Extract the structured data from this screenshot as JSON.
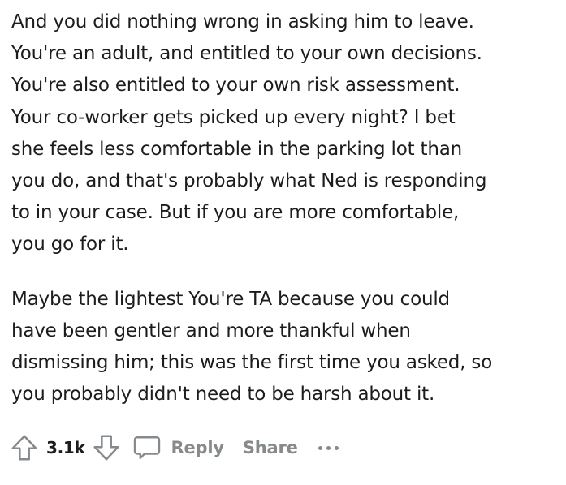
{
  "comment": {
    "paragraphs": [
      {
        "lines": [
          "And you did nothing wrong in asking him to leave.",
          "You're an adult, and entitled to your own decisions.",
          "You're also entitled to your own risk assessment.",
          "Your co-worker gets picked up every night? I bet",
          "she feels less comfortable in the parking lot than",
          "you do, and that's probably what Ned is responding",
          "to in your case. But if you are more comfortable,",
          "you go for it."
        ]
      },
      {
        "lines": [
          "Maybe the lightest You're TA because you could",
          "have been gentler and more thankful when",
          "dismissing him; this was the first time you asked, so",
          "you probably didn't need to be harsh about it."
        ]
      }
    ]
  },
  "actions": {
    "score": "3.1k",
    "reply_label": "Reply",
    "share_label": "Share",
    "icons": {
      "upvote": "upvote-arrow-icon",
      "downvote": "downvote-arrow-icon",
      "reply": "speech-bubble-icon",
      "more": "more-dots-icon"
    }
  },
  "colors": {
    "text": "#1c1c1c",
    "muted": "#878a8c",
    "background": "#ffffff"
  }
}
